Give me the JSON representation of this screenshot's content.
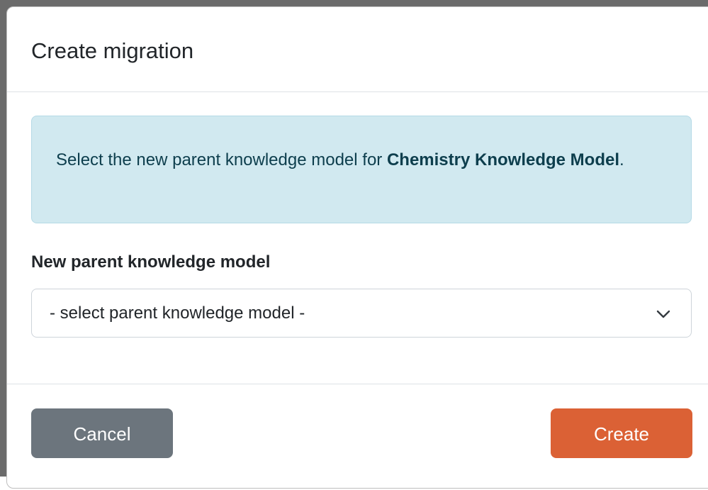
{
  "modal": {
    "title": "Create migration",
    "alert": {
      "text_before": "Select the new parent knowledge model for ",
      "bold_name": "Chemistry Knowledge Model",
      "text_after": "."
    },
    "field": {
      "label": "New parent knowledge model",
      "select_value": "- select parent knowledge model -",
      "icon": "chevron-down-icon"
    },
    "footer": {
      "cancel_label": "Cancel",
      "create_label": "Create"
    }
  },
  "colors": {
    "alert_background": "#d1e9f0",
    "alert_text": "#0d3e4d",
    "cancel_button": "#6c757d",
    "create_button": "#db6135"
  }
}
